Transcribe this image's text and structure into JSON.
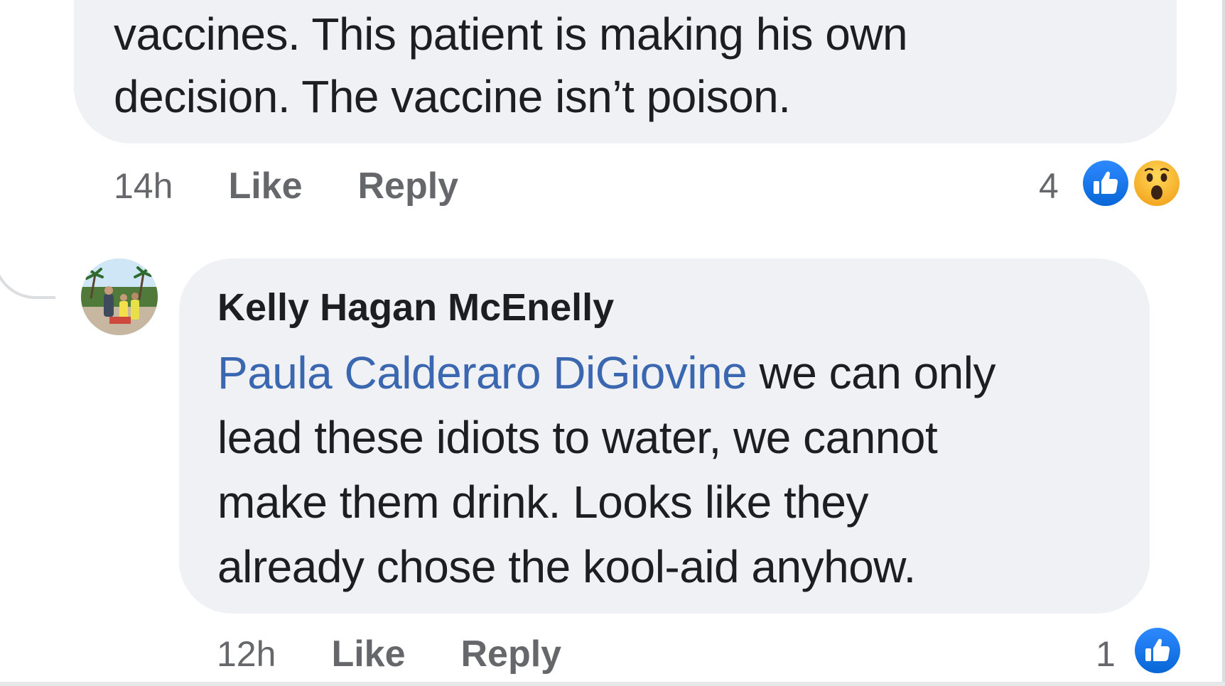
{
  "comments": [
    {
      "text_lines": [
        "vaccines. This patient is making his own",
        "decision. The vaccine isn’t poison."
      ],
      "time": "14h",
      "like_label": "Like",
      "reply_label": "Reply",
      "reaction_count": "4",
      "reactions": [
        "like-icon",
        "wow-icon"
      ]
    },
    {
      "author": "Kelly Hagan McEnelly",
      "mention": "Paula Calderaro DiGiovine",
      "text_after_mention": " we can only",
      "text_lines": [
        "lead these idiots to water, we cannot",
        "make them drink. Looks like they",
        "already chose the kool-aid anyhow."
      ],
      "time": "12h",
      "like_label": "Like",
      "reply_label": "Reply",
      "reaction_count": "1",
      "reactions": [
        "like-icon"
      ]
    }
  ],
  "colors": {
    "bubble": "#eff1f4",
    "text": "#1c1e21",
    "meta": "#65676b",
    "mention": "#3a67b0",
    "like_reaction": "#1b74e4",
    "wow_reaction": "#f7b125"
  }
}
